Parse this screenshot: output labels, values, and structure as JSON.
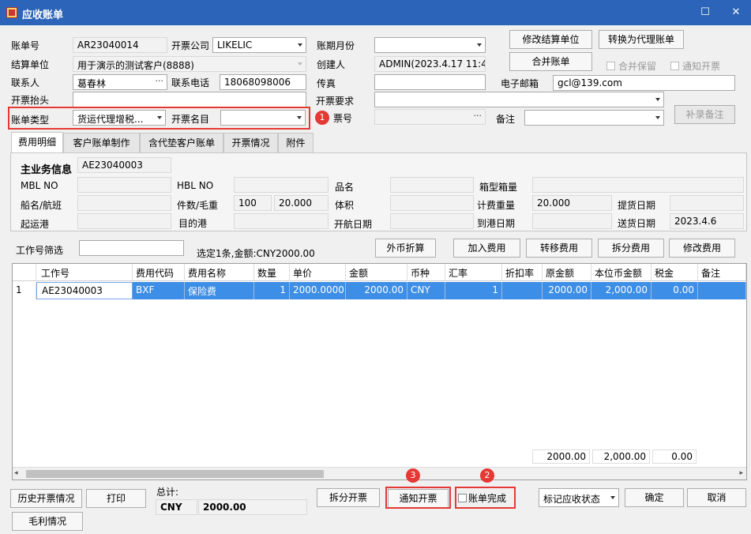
{
  "window": {
    "title": "应收账单",
    "min_glyph": "☐",
    "close_glyph": "✕"
  },
  "header": {
    "bill_no_label": "账单号",
    "bill_no": "AR23040014",
    "invoice_company_label": "开票公司",
    "invoice_company": "LIKELIC",
    "period_label": "账期月份",
    "period": "",
    "settle_unit_label": "结算单位",
    "settle_unit": "用于演示的测试客户(8888)",
    "creator_label": "创建人",
    "creator": "ADMIN(2023.4.17 11:4!",
    "contact_label": "联系人",
    "contact": "葛春林",
    "phone_label": "联系电话",
    "phone": "18068098006",
    "fax_label": "传真",
    "fax": "",
    "email_label": "电子邮箱",
    "email": "gcl@139.com",
    "invoice_title_label": "开票抬头",
    "invoice_title": "",
    "invoice_req_label": "开票要求",
    "invoice_req": "",
    "bill_type_label": "账单类型",
    "bill_type": "货运代理增税...",
    "invoice_item_label": "开票名目",
    "invoice_item": "",
    "invoice_no_label": "票号",
    "invoice_no": "",
    "remark_label": "备注",
    "remark": ""
  },
  "top_buttons": {
    "modify_settle": "修改结算单位",
    "convert_agent": "转换为代理账单",
    "merge_bill": "合并账单",
    "add_remark": "补录备注",
    "merge_keep": "合并保留",
    "notify_invoice_chk": "通知开票"
  },
  "tabs": [
    "费用明细",
    "客户账单制作",
    "含代垫客户账单",
    "开票情况",
    "附件"
  ],
  "business": {
    "title": "主业务信息",
    "job_no": "AE23040003",
    "mbl_label": "MBL NO",
    "mbl": "",
    "hbl_label": "HBL NO",
    "hbl": "",
    "product_label": "品名",
    "product": "",
    "container_label": "箱型箱量",
    "container": "",
    "vessel_label": "船名/航班",
    "vessel": "",
    "pieces_label": "件数/毛重",
    "pieces": "100",
    "gross_weight": "20.000",
    "volume_label": "体积",
    "volume": "",
    "charge_weight_label": "计费重量",
    "charge_weight": "20.000",
    "pickup_label": "提货日期",
    "pickup": "",
    "pol_label": "起运港",
    "pol": "",
    "pod_label": "目的港",
    "pod": "",
    "sail_label": "开航日期",
    "sail": "",
    "arrive_label": "到港日期",
    "arrive": "",
    "delivery_label": "送货日期",
    "delivery": "2023.4.6"
  },
  "filter": {
    "label": "工作号筛选",
    "value": "",
    "summary": "选定1条,金额:CNY2000.00",
    "fx_btn": "外币折算",
    "add_btn": "加入费用",
    "move_btn": "转移费用",
    "split_btn": "拆分费用",
    "edit_btn": "修改费用"
  },
  "grid": {
    "columns": [
      "工作号",
      "费用代码",
      "费用名称",
      "数量",
      "单价",
      "金额",
      "币种",
      "汇率",
      "折扣率",
      "原金额",
      "本位币金额",
      "税金",
      "备注"
    ],
    "rows": [
      {
        "idx": "1",
        "job_no": "AE23040003",
        "code": "BXF",
        "name": "保险费",
        "qty": "1",
        "price": "2000.0000",
        "amount": "2000.00",
        "currency": "CNY",
        "rate": "1",
        "discount": "",
        "orig_amount": "2000.00",
        "base_amount": "2,000.00",
        "tax": "0.00",
        "remark": ""
      }
    ],
    "sum_orig": "2000.00",
    "sum_base": "2,000.00",
    "sum_tax": "0.00"
  },
  "footer": {
    "history_btn": "历史开票情况",
    "print_btn": "打印",
    "profit_btn": "毛利情况",
    "total_label": "总计:",
    "total_currency": "CNY",
    "total_amount": "2000.00",
    "split_invoice_btn": "拆分开票",
    "notify_invoice_btn": "通知开票",
    "bill_done_label": "账单完成",
    "mark_status": "标记应收状态",
    "ok_btn": "确定",
    "cancel_btn": "取消"
  },
  "badges": [
    "1",
    "2",
    "3"
  ],
  "colors": {
    "titlebar": "#2b64b8",
    "selection": "#3d8ee6",
    "highlight_red": "#e53935"
  }
}
